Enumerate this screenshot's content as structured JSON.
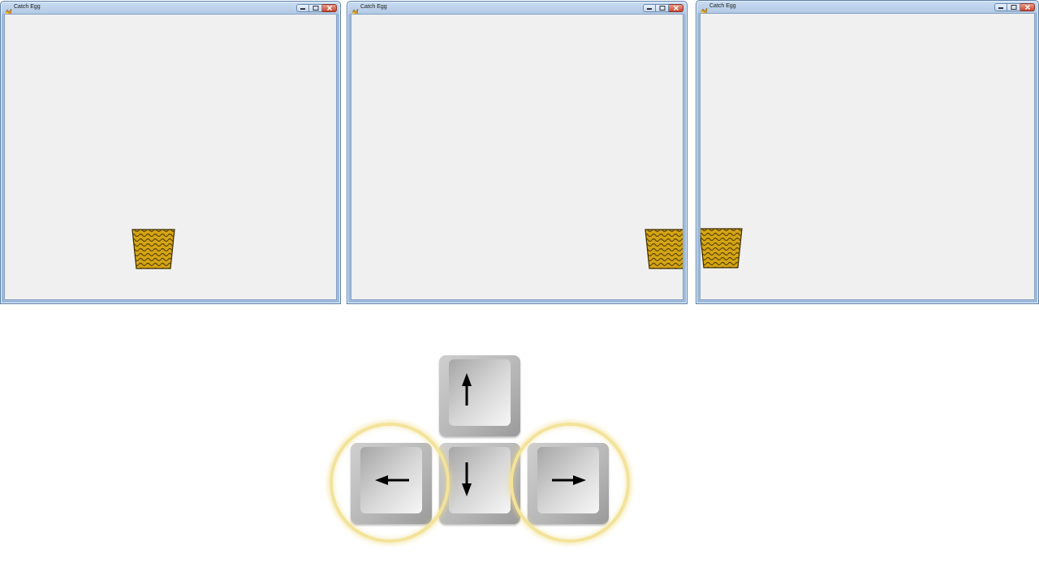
{
  "windows": [
    {
      "title": "Catch Egg",
      "icon": "app-icon",
      "basket_icon": "basket-icon"
    },
    {
      "title": "Catch Egg",
      "icon": "app-icon",
      "basket_icon": "basket-icon"
    },
    {
      "title": "Catch Egg",
      "icon": "app-icon",
      "basket_icon": "basket-icon"
    }
  ],
  "window_controls": [
    "minimize-icon",
    "maximize-icon",
    "close-icon"
  ],
  "keys": {
    "up": "arrow-up-icon",
    "down": "arrow-down-icon",
    "left": "arrow-left-icon",
    "right": "arrow-right-icon"
  },
  "highlighted_keys": [
    "left",
    "right"
  ],
  "colors": {
    "client_bg": "#f0f0f0",
    "basket": "#d4a514",
    "highlight_ring": "#f3e39a",
    "close_button": "#c8452d"
  }
}
